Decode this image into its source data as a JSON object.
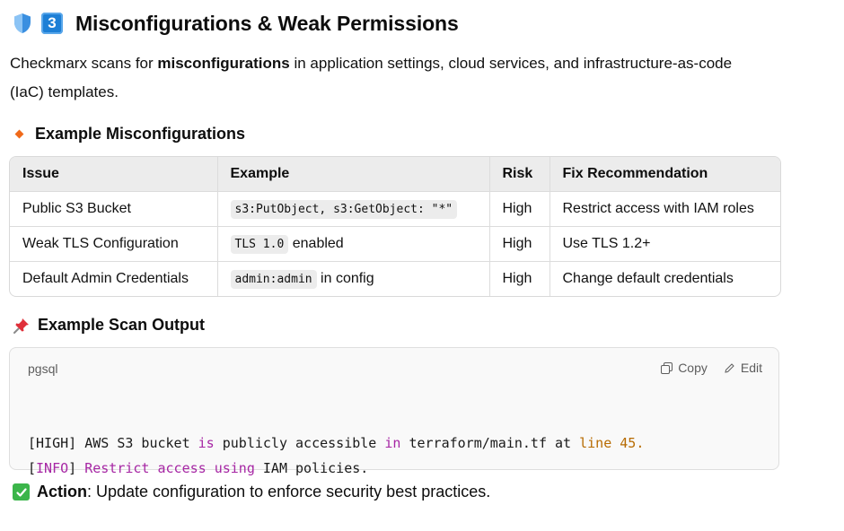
{
  "heading": {
    "number": "3",
    "title": "Misconfigurations & Weak Permissions"
  },
  "intro": {
    "before": "Checkmarx scans for ",
    "bold": "misconfigurations",
    "after": " in application settings, cloud services, and infrastructure-as-code (IaC) templates."
  },
  "table_section": {
    "title": "Example Misconfigurations",
    "headers": [
      "Issue",
      "Example",
      "Risk",
      "Fix Recommendation"
    ],
    "rows": [
      {
        "issue": "Public S3 Bucket",
        "code": "s3:PutObject, s3:GetObject: \"*\"",
        "after": "",
        "risk": "High",
        "fix": "Restrict access with IAM roles"
      },
      {
        "issue": "Weak TLS Configuration",
        "code": "TLS 1.0",
        "after": " enabled",
        "risk": "High",
        "fix": "Use TLS 1.2+"
      },
      {
        "issue": "Default Admin Credentials",
        "code": "admin:admin",
        "after": " in config",
        "risk": "High",
        "fix": "Change default credentials"
      }
    ]
  },
  "scan_section": {
    "title": "Example Scan Output",
    "language": "pgsql",
    "copy_label": "Copy",
    "edit_label": "Edit",
    "line1": {
      "a": "[HIGH] AWS S3 bucket ",
      "kw1": "is",
      "b": " publicly accessible ",
      "kw2": "in",
      "c": " terraform/main.tf at ",
      "num": "line 45."
    },
    "line2": {
      "a": "[",
      "kw1": "INFO",
      "b": "] ",
      "kw2": "Restrict access using",
      "c": " IAM policies."
    }
  },
  "action": {
    "label": "Action",
    "text": ": Update configuration to enforce security best practices."
  }
}
